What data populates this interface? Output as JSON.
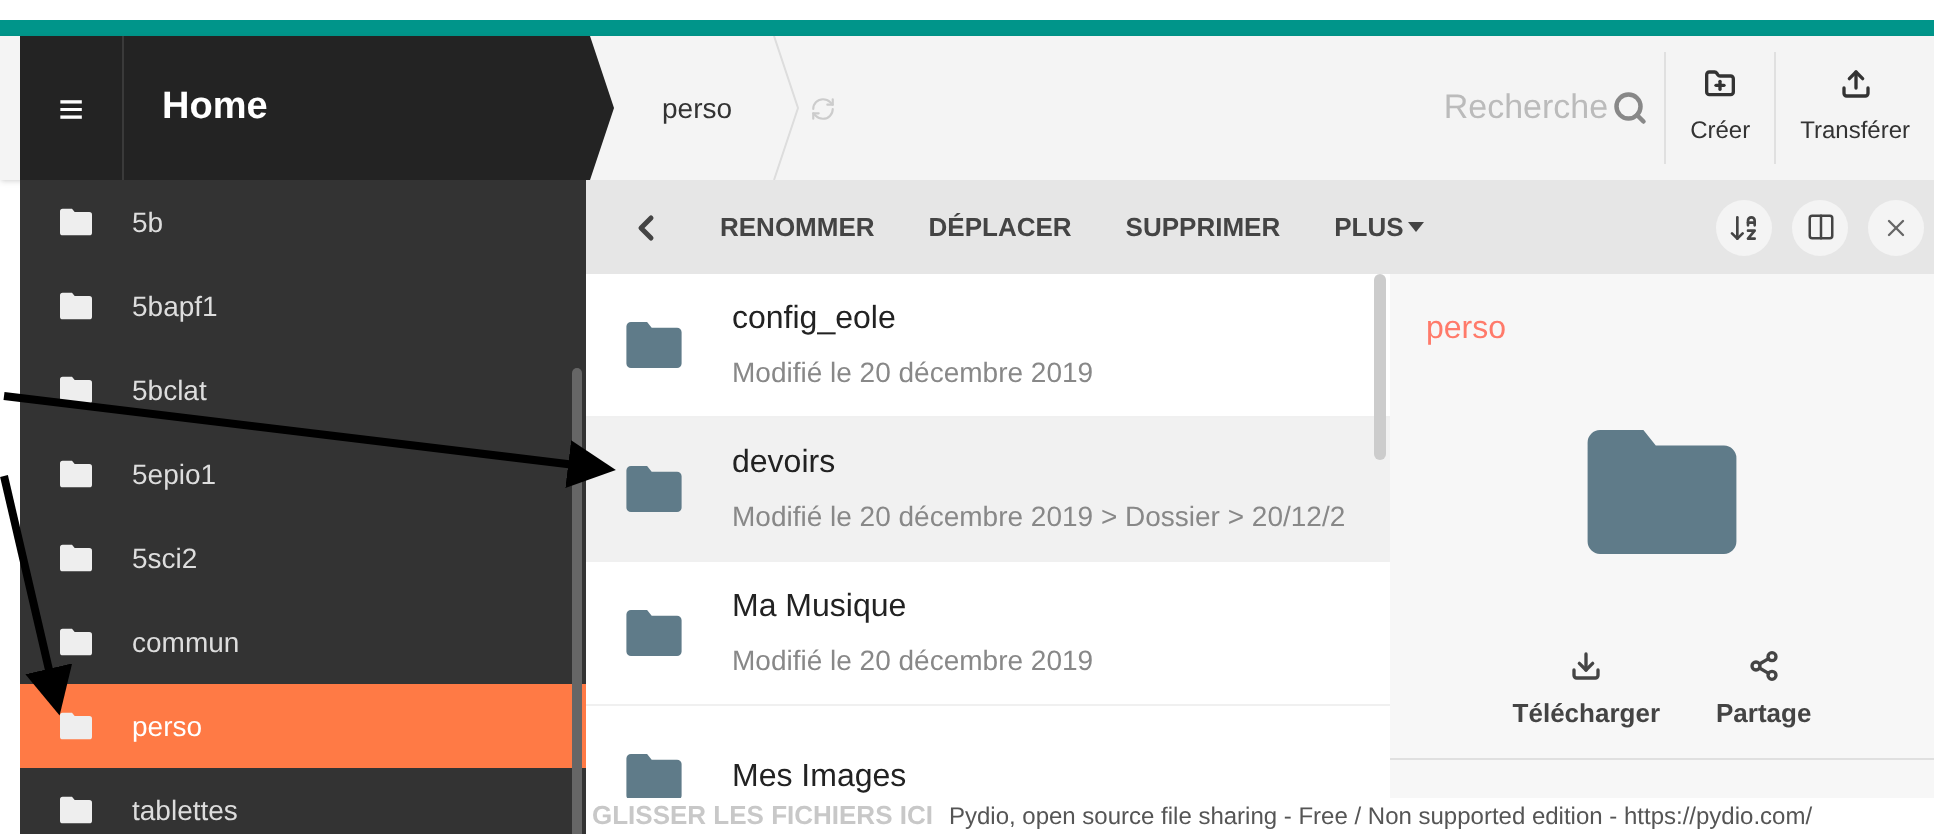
{
  "header": {
    "menu_icon": "≡",
    "title": "Home",
    "breadcrumb": "perso",
    "search_placeholder": "Recherche",
    "actions": [
      {
        "kind": "create",
        "label": "Créer"
      },
      {
        "kind": "upload",
        "label": "Transférer"
      }
    ]
  },
  "sidebar": {
    "items": [
      {
        "label": "5b",
        "selected": false
      },
      {
        "label": "5bapf1",
        "selected": false
      },
      {
        "label": "5bclat",
        "selected": false
      },
      {
        "label": "5epio1",
        "selected": false
      },
      {
        "label": "5sci2",
        "selected": false
      },
      {
        "label": "commun",
        "selected": false
      },
      {
        "label": "perso",
        "selected": true
      },
      {
        "label": "tablettes",
        "selected": false
      }
    ]
  },
  "toolbar": {
    "actions": [
      {
        "kind": "text",
        "label": "RENOMMER"
      },
      {
        "kind": "text",
        "label": "DÉPLACER"
      },
      {
        "kind": "text",
        "label": "SUPPRIMER"
      },
      {
        "kind": "menu",
        "label": "PLUS"
      }
    ]
  },
  "files": [
    {
      "name": "config_eole",
      "meta": "Modifié le 20 décembre 2019",
      "highlighted": false
    },
    {
      "name": "devoirs",
      "meta": "Modifié le 20 décembre 2019 > Dossier > 20/12/2",
      "highlighted": true
    },
    {
      "name": "Ma Musique",
      "meta": "Modifié le 20 décembre 2019",
      "highlighted": false
    },
    {
      "name": "Mes Images",
      "highlighted": false
    }
  ],
  "details": {
    "title": "perso",
    "actions": [
      {
        "kind": "download",
        "label": "Télécharger"
      },
      {
        "kind": "share",
        "label": "Partage"
      }
    ]
  },
  "drop_hint": "GLISSER LES FICHIERS ICI",
  "footer": "Pydio, open source file sharing - Free / Non supported edition - https://pydio.com/"
}
